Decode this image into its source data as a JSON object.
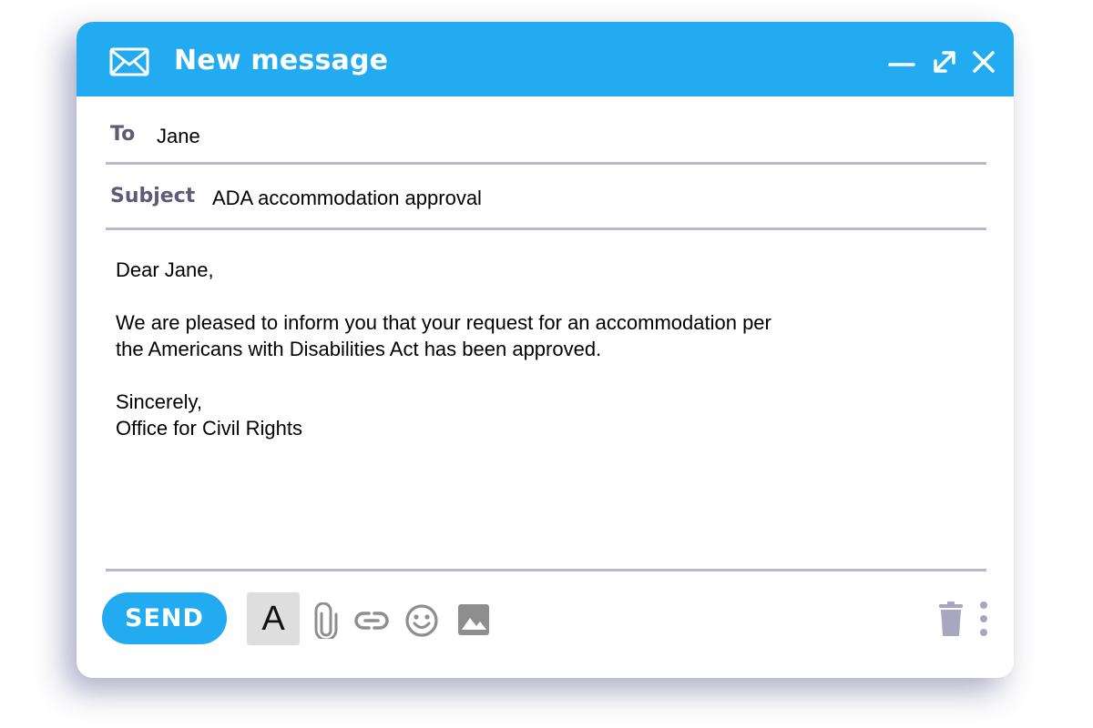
{
  "window": {
    "title": "New message",
    "accent_color": "#22abf0",
    "icons": {
      "envelope": "envelope-icon",
      "minimize": "minimize-icon",
      "expand": "expand-icon",
      "close": "close-icon"
    }
  },
  "compose": {
    "to_label": "To",
    "to_value": "Jane",
    "subject_label": "Subject",
    "subject_value": "ADA accommodation approval",
    "body": {
      "greeting": "Dear Jane,",
      "paragraph_line1": "We are pleased to inform you that your request for an accommodation per",
      "paragraph_line2": "the Americans with Disabilities Act has been approved.",
      "closing": "Sincerely,",
      "signature": "Office for Civil Rights"
    }
  },
  "toolbar": {
    "send_label": "SEND",
    "format_label": "A",
    "icons": {
      "attach": "paperclip-icon",
      "link": "link-icon",
      "emoji": "emoji-icon",
      "image": "image-icon",
      "delete": "trash-icon",
      "more": "more-options-icon"
    },
    "icon_color": "#8e8e8e",
    "trash_color": "#a9a7c0"
  }
}
